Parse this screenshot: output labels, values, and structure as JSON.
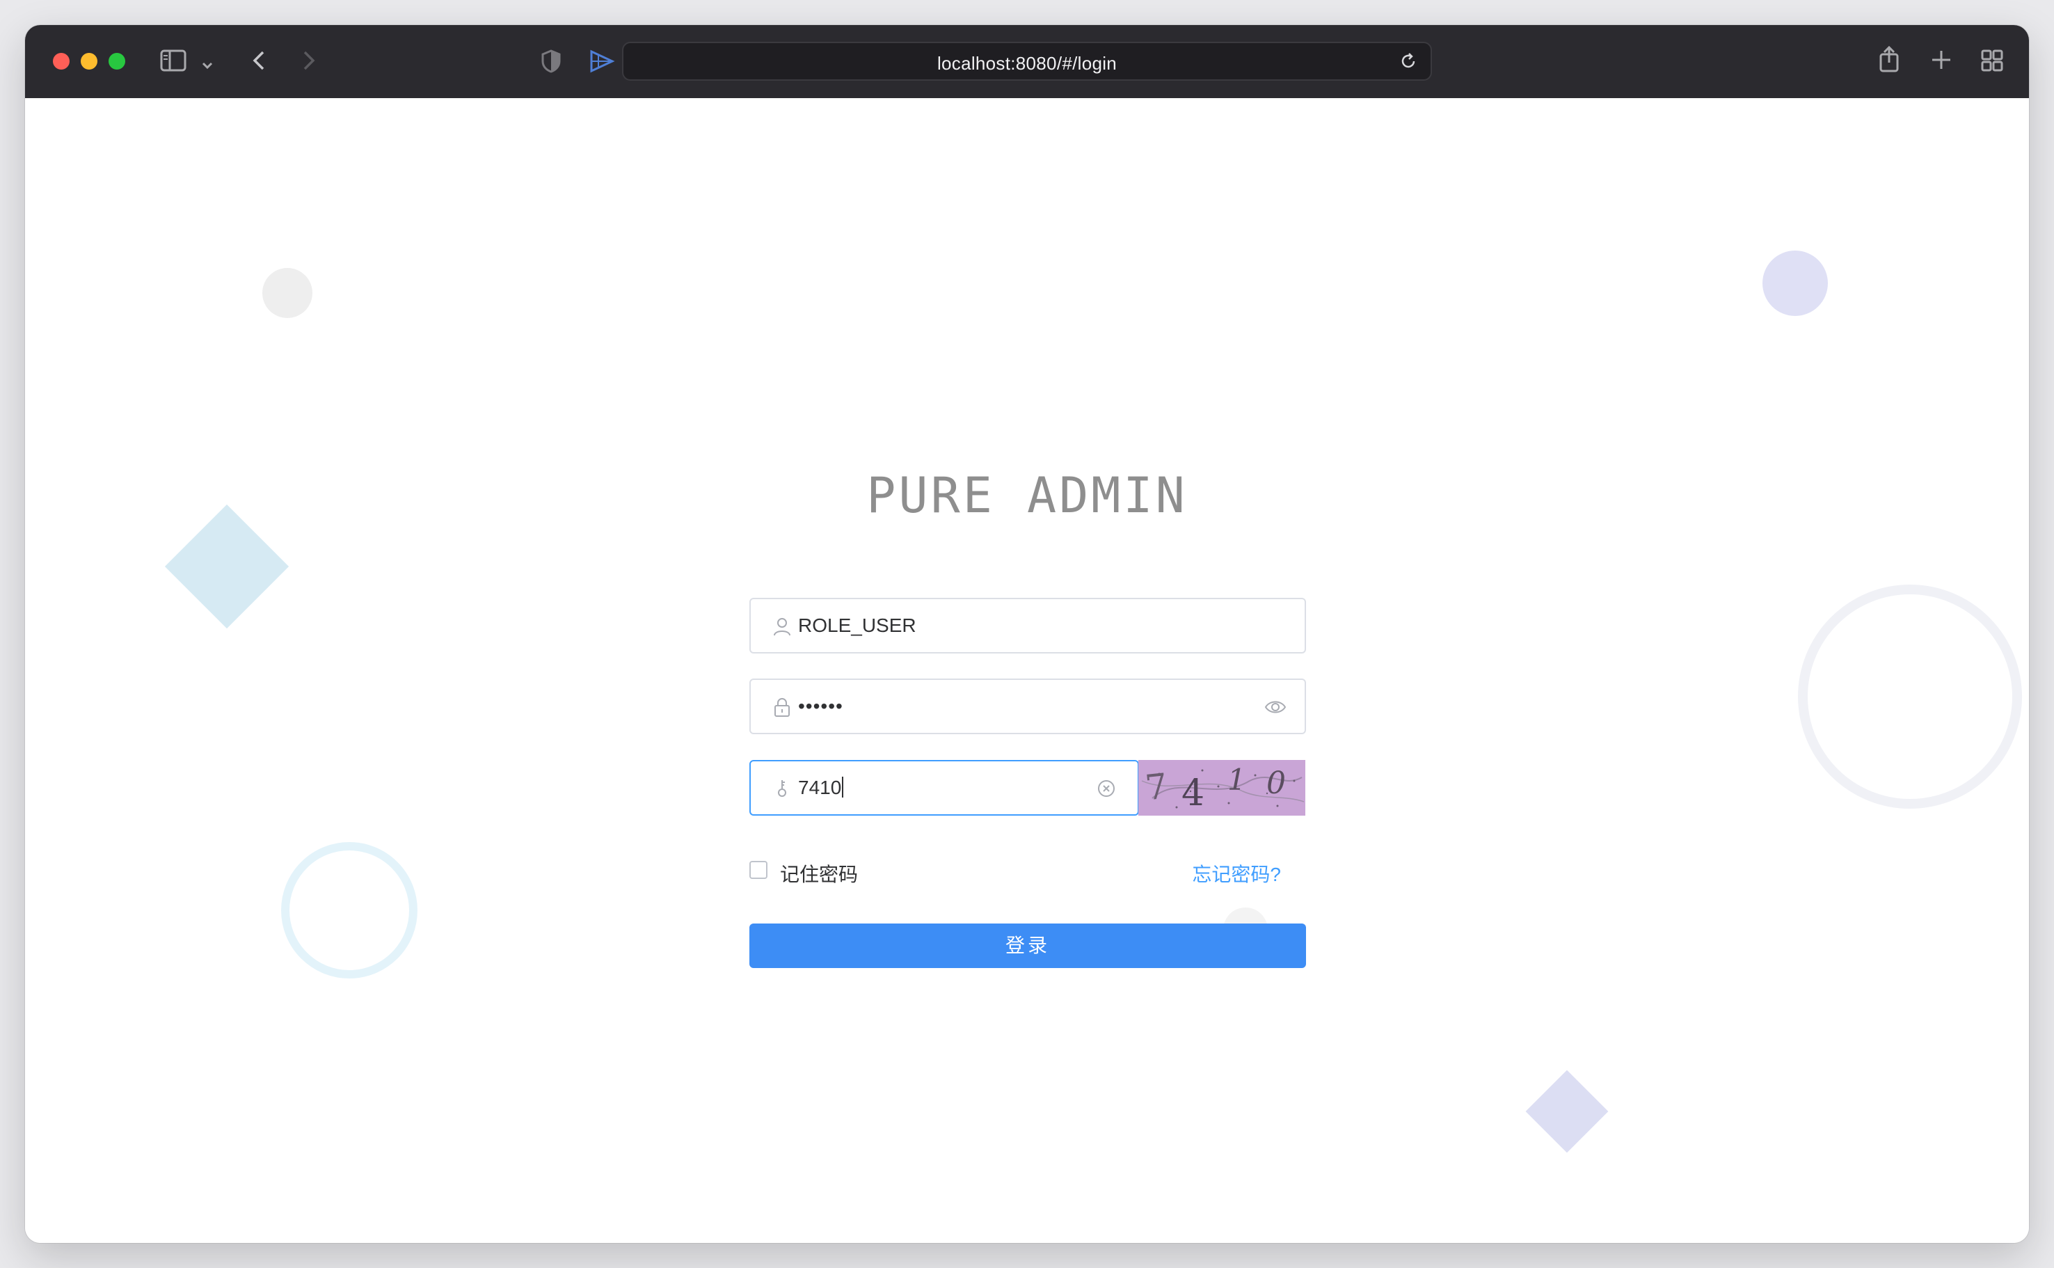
{
  "browser": {
    "url": "localhost:8080/#/login",
    "icons": {
      "sidebar": "sidebar-icon",
      "back": "chevron-left-icon",
      "forward": "chevron-right-icon",
      "shield": "shield-icon",
      "extension": "extension-icon",
      "reload": "reload-icon",
      "share": "share-icon",
      "new_tab": "plus-icon",
      "tab_overview": "grid-icon"
    }
  },
  "login": {
    "title": "PURE ADMIN",
    "username": {
      "value": "ROLE_USER",
      "icon": "user-icon"
    },
    "password": {
      "value": "••••••",
      "icon": "lock-icon",
      "toggle_icon": "eye-icon"
    },
    "verify_code": {
      "value": "7410",
      "icon": "key-icon",
      "clear_icon": "clear-icon"
    },
    "captcha_chars": [
      "7",
      "4",
      "1",
      "0"
    ],
    "remember_label": "记住密码",
    "forgot_label": "忘记密码?",
    "submit_label": "登录"
  },
  "colors": {
    "primary": "#409eff",
    "button": "#3d8df5",
    "titlebar": "#2b2a2f",
    "captcha_bg": "#c9a5d6"
  }
}
